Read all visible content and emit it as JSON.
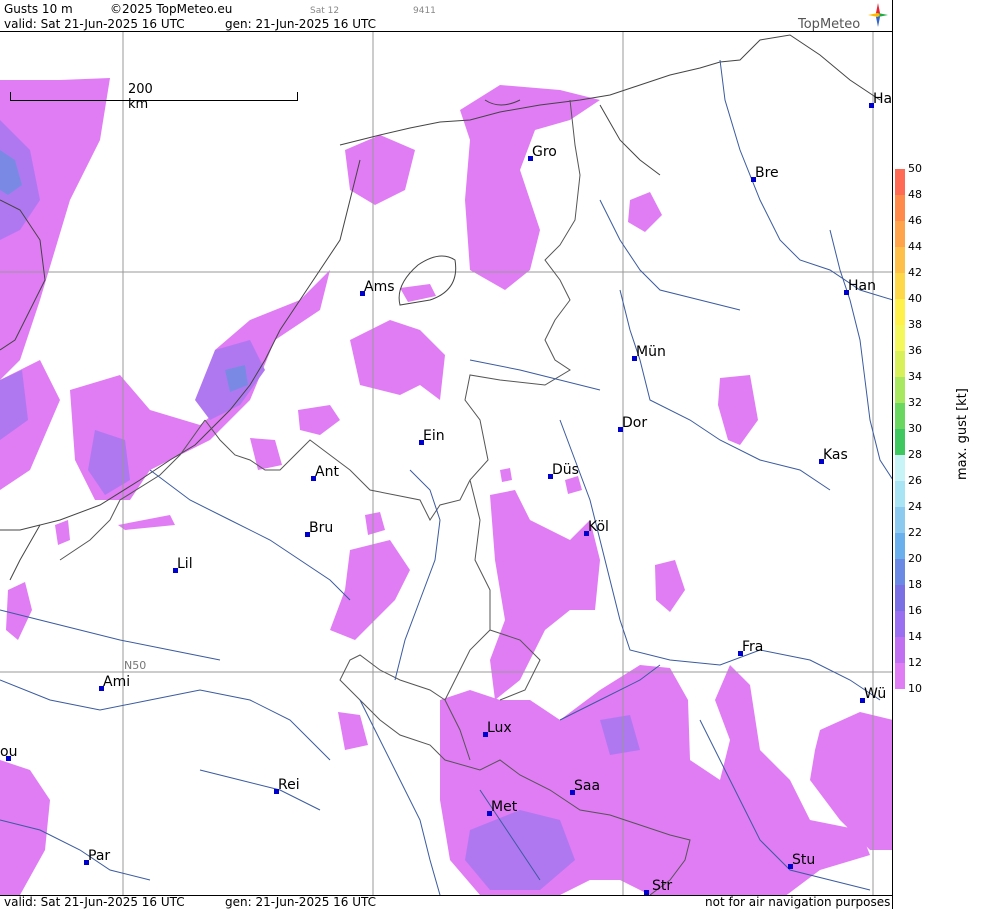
{
  "header": {
    "product": "Gusts 10 m",
    "copyright": "©2025 TopMeteo.eu",
    "sat_label": "Sat 12",
    "code": "9411",
    "valid": "valid:  Sat  21-Jun-2025  16 UTC",
    "gen": "gen: 21-Jun-2025 16 UTC"
  },
  "footer": {
    "valid": "valid:  Sat  21-Jun-2025  16 UTC",
    "gen": "gen: 21-Jun-2025 16 UTC",
    "notice": "not for air navigation purposes"
  },
  "logo": {
    "text": "TopMeteo"
  },
  "scale_bar": {
    "label": "200 km"
  },
  "graticule": {
    "lat_label": "N50"
  },
  "legend": {
    "title": "max. gust [kt]",
    "ticks": [
      "50",
      "48",
      "46",
      "44",
      "42",
      "40",
      "38",
      "36",
      "34",
      "32",
      "30",
      "28",
      "26",
      "24",
      "22",
      "20",
      "18",
      "16",
      "14",
      "12",
      "10"
    ],
    "colors": [
      "#ff6a55",
      "#ff8a4a",
      "#ffa44a",
      "#ffc04a",
      "#ffd84a",
      "#fff04a",
      "#f4f85a",
      "#d8f05a",
      "#a8e860",
      "#6ad860",
      "#40c860",
      "#c8f4f8",
      "#a8e4f4",
      "#8ccaf0",
      "#6ab0ec",
      "#6a8ae4",
      "#7a70e4",
      "#9a70f0",
      "#c070f0",
      "#e07cf4"
    ]
  },
  "cities": [
    {
      "name": "Gro"
    },
    {
      "name": "Bre"
    },
    {
      "name": "Ha"
    },
    {
      "name": "Ams"
    },
    {
      "name": "Han"
    },
    {
      "name": "Mün"
    },
    {
      "name": "Dor"
    },
    {
      "name": "Ein"
    },
    {
      "name": "Kas"
    },
    {
      "name": "Ant"
    },
    {
      "name": "Düs"
    },
    {
      "name": "Köl"
    },
    {
      "name": "Bru"
    },
    {
      "name": "Lil"
    },
    {
      "name": "Fra"
    },
    {
      "name": "Ami"
    },
    {
      "name": "Wü"
    },
    {
      "name": "Lux"
    },
    {
      "name": "ou"
    },
    {
      "name": "Rei"
    },
    {
      "name": "Saa"
    },
    {
      "name": "Met"
    },
    {
      "name": "Stu"
    },
    {
      "name": "Par"
    },
    {
      "name": "Str"
    }
  ]
}
